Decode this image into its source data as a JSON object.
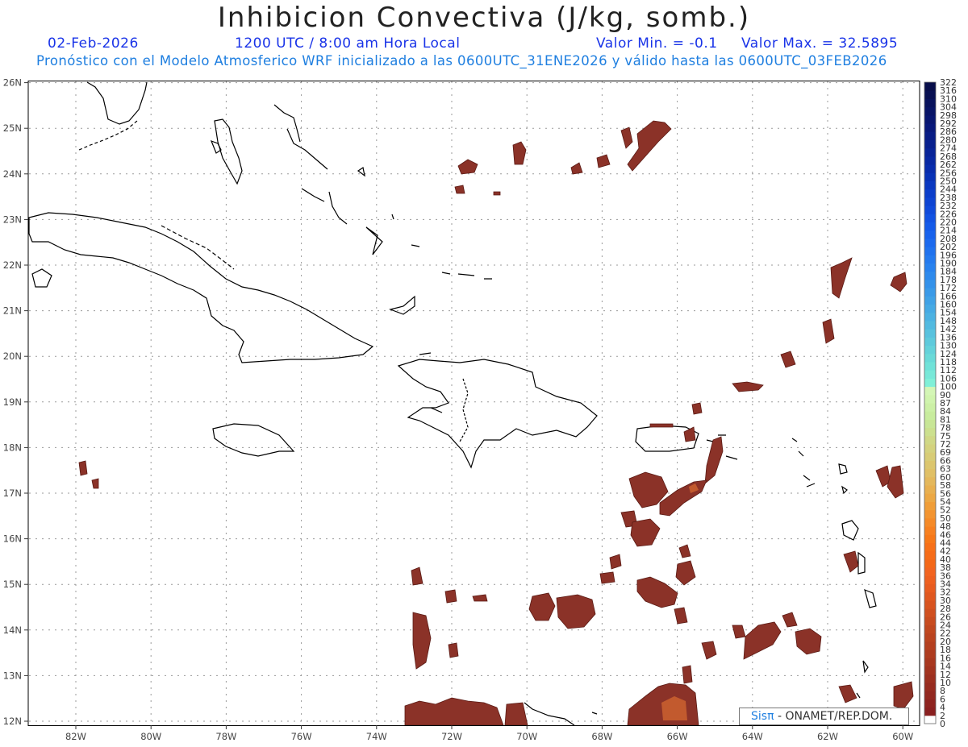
{
  "title": "Inhibicion Convectiva (J/kg, somb.)",
  "date": "02-Feb-2026",
  "time": "1200 UTC / 8:00 am Hora Local",
  "value_min": "Valor Min. = -0.1",
  "value_max": "Valor Max. = 32.5895",
  "forecast_note": "Pronóstico con el Modelo Atmosferico WRF inicializado a las 0600UTC_31ENE2026 y válido hasta las  0600UTC_03FEB2026",
  "credit": {
    "logo": "Sisπ",
    "text": " - ONAMET/REP.DOM."
  },
  "lon_labels": [
    "82W",
    "80W",
    "78W",
    "76W",
    "74W",
    "72W",
    "70W",
    "68W",
    "66W",
    "64W",
    "62W",
    "60W"
  ],
  "lat_labels": [
    "12N",
    "13N",
    "14N",
    "15N",
    "16N",
    "17N",
    "18N",
    "19N",
    "20N",
    "21N",
    "22N",
    "23N",
    "24N",
    "25N",
    "26N"
  ],
  "colorbar": {
    "labels": [
      "0",
      "2",
      "4",
      "6",
      "8",
      "10",
      "12",
      "14",
      "16",
      "18",
      "20",
      "22",
      "24",
      "26",
      "28",
      "30",
      "32",
      "34",
      "36",
      "38",
      "40",
      "42",
      "44",
      "46",
      "48",
      "50",
      "52",
      "54",
      "56",
      "58",
      "60",
      "63",
      "66",
      "69",
      "72",
      "75",
      "78",
      "81",
      "84",
      "87",
      "90",
      "100",
      "106",
      "112",
      "118",
      "124",
      "130",
      "136",
      "142",
      "148",
      "154",
      "160",
      "166",
      "172",
      "178",
      "184",
      "190",
      "196",
      "202",
      "208",
      "214",
      "220",
      "226",
      "232",
      "238",
      "244",
      "250",
      "256",
      "262",
      "268",
      "274",
      "280",
      "286",
      "292",
      "298",
      "304",
      "310",
      "316",
      "322"
    ],
    "colors": [
      "#ffffff",
      "#8a2020",
      "#8e2420",
      "#922820",
      "#972c20",
      "#9c3020",
      "#a23420",
      "#a83820",
      "#ae3c20",
      "#b44020",
      "#ba4420",
      "#c04820",
      "#c84c20",
      "#d05020",
      "#d85420",
      "#e05820",
      "#e85c20",
      "#ee6020",
      "#f26420",
      "#f46818",
      "#f66c18",
      "#f77018",
      "#f77818",
      "#f78020",
      "#f58a28",
      "#f39430",
      "#f09e38",
      "#eca844",
      "#e8b050",
      "#e4b85c",
      "#e0c066",
      "#dcc66e",
      "#d8cc76",
      "#d4d27e",
      "#d0d886",
      "#cce08e",
      "#c8e696",
      "#c8ec9e",
      "#ccf0a6",
      "#d0f4ae",
      "#d4f6b6",
      "#80f0d8",
      "#78e8d8",
      "#70e2d8",
      "#6adad8",
      "#64d2da",
      "#5ecadc",
      "#58c2de",
      "#52bae0",
      "#4cb2e2",
      "#46aae4",
      "#40a2e6",
      "#3a9ae8",
      "#3492ea",
      "#2e8aec",
      "#2882ee",
      "#247aee",
      "#2072ee",
      "#1c6aee",
      "#1862ec",
      "#145ae8",
      "#1252e2",
      "#104ada",
      "#0e44d2",
      "#0c3eca",
      "#0a38c0",
      "#0832b6",
      "#082cac",
      "#0828a2",
      "#082498",
      "#08208e",
      "#081c84",
      "#08187a",
      "#081670",
      "#081466",
      "#08125c",
      "#081052",
      "#080e4a",
      "#080c44"
    ]
  }
}
